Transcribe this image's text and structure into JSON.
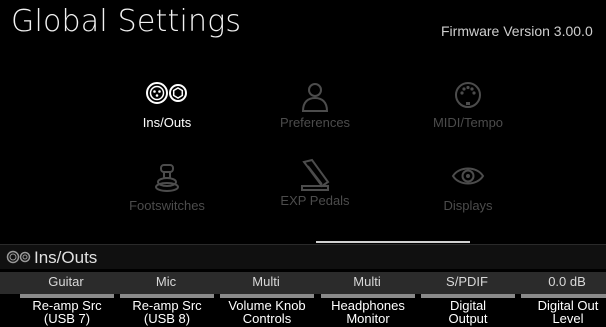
{
  "header": {
    "title": "Global Settings",
    "firmware": "Firmware Version 3.00.0"
  },
  "grid": [
    {
      "label": "Ins/Outs",
      "icon": "ins-outs-icon",
      "active": true
    },
    {
      "label": "Preferences",
      "icon": "person-icon",
      "active": false
    },
    {
      "label": "MIDI/Tempo",
      "icon": "midi-icon",
      "active": false
    },
    {
      "label": "Footswitches",
      "icon": "footswitch-icon",
      "active": false
    },
    {
      "label": "EXP Pedals",
      "icon": "exp-pedal-icon",
      "active": false
    },
    {
      "label": "Displays",
      "icon": "eye-icon",
      "active": false
    }
  ],
  "section": {
    "title": "Ins/Outs",
    "icon": "ins-outs-icon"
  },
  "params": [
    {
      "value": "Guitar",
      "line1": "Re-amp Src",
      "line2": "(USB 7)"
    },
    {
      "value": "Mic",
      "line1": "Re-amp Src",
      "line2": "(USB 8)"
    },
    {
      "value": "Multi",
      "line1": "Volume Knob",
      "line2": "Controls"
    },
    {
      "value": "Multi",
      "line1": "Headphones",
      "line2": "Monitor"
    },
    {
      "value": "S/PDIF",
      "line1": "Digital",
      "line2": "Output"
    },
    {
      "value": "0.0 dB",
      "line1": "Digital Out",
      "line2": "Level"
    }
  ],
  "colors": {
    "background": "#000000",
    "active_label": "#ffffff",
    "inactive_label": "#4c4c4c"
  }
}
